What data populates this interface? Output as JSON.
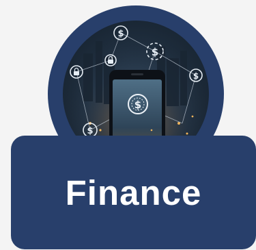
{
  "card": {
    "title": "Finance"
  },
  "image": {
    "subject": "hand holding smartphone over city skyline with dollar icons",
    "icons": [
      "dollar-icon",
      "lock-icon",
      "dollar-icon",
      "lock-icon",
      "dollar-icon"
    ]
  },
  "colors": {
    "primary": "#283f6b",
    "background": "#f4f4f4",
    "text": "#ffffff"
  }
}
